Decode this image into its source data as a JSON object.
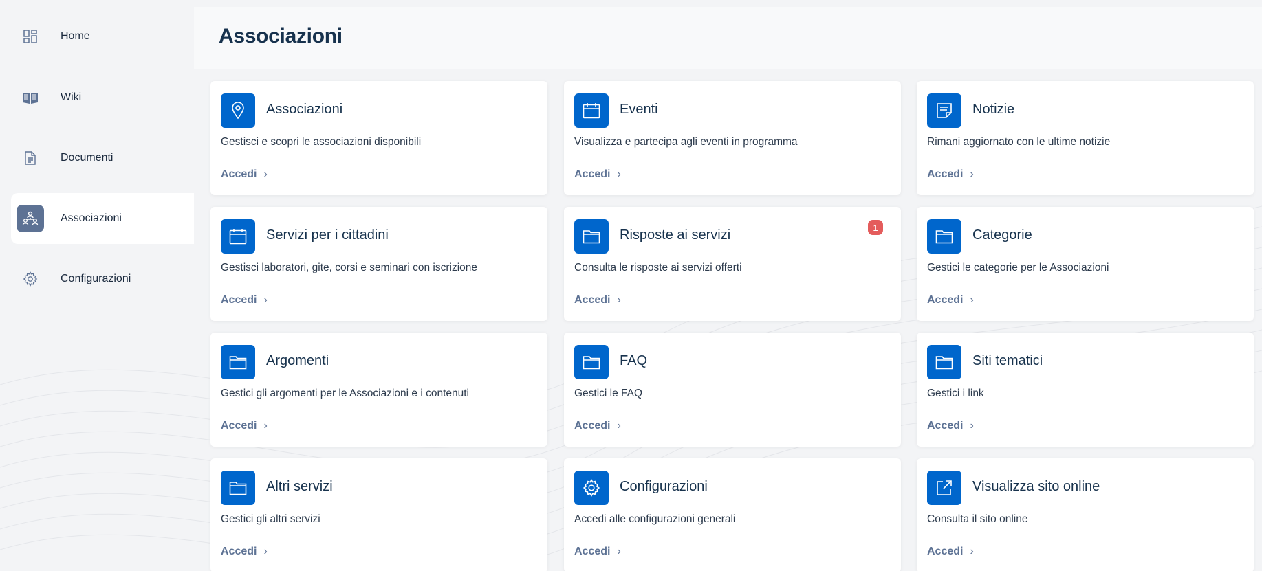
{
  "sidebar": {
    "items": [
      {
        "label": "Home",
        "icon": "dashboard-icon",
        "active": false
      },
      {
        "label": "Wiki",
        "icon": "book-icon",
        "active": false
      },
      {
        "label": "Documenti",
        "icon": "document-icon",
        "active": false
      },
      {
        "label": "Associazioni",
        "icon": "people-network-icon",
        "active": true
      },
      {
        "label": "Configurazioni",
        "icon": "gear-icon",
        "active": false
      }
    ]
  },
  "header": {
    "title": "Associazioni"
  },
  "cards": [
    {
      "title": "Associazioni",
      "description": "Gestisci e scopri le associazioni disponibili",
      "link": "Accedi",
      "icon": "map-pin-icon"
    },
    {
      "title": "Eventi",
      "description": "Visualizza e partecipa agli eventi in programma",
      "link": "Accedi",
      "icon": "calendar-icon"
    },
    {
      "title": "Notizie",
      "description": "Rimani aggiornato con le ultime notizie",
      "link": "Accedi",
      "icon": "news-icon"
    },
    {
      "title": "Servizi per i cittadini",
      "description": "Gestisci laboratori, gite, corsi e seminari con iscrizione",
      "link": "Accedi",
      "icon": "calendar-icon"
    },
    {
      "title": "Risposte ai servizi",
      "description": "Consulta le risposte ai servizi offerti",
      "link": "Accedi",
      "icon": "folder-icon",
      "badge": "1"
    },
    {
      "title": "Categorie",
      "description": "Gestici le categorie per le Associazioni",
      "link": "Accedi",
      "icon": "folder-icon"
    },
    {
      "title": "Argomenti",
      "description": "Gestici gli argomenti per le Associazioni e i contenuti",
      "link": "Accedi",
      "icon": "folder-icon"
    },
    {
      "title": "FAQ",
      "description": "Gestici le FAQ",
      "link": "Accedi",
      "icon": "folder-icon"
    },
    {
      "title": "Siti tematici",
      "description": "Gestici i link",
      "link": "Accedi",
      "icon": "folder-icon"
    },
    {
      "title": "Altri servizi",
      "description": "Gestici gli altri servizi",
      "link": "Accedi",
      "icon": "folder-icon"
    },
    {
      "title": "Configurazioni",
      "description": "Accedi alle configurazioni generali",
      "link": "Accedi",
      "icon": "gear-icon"
    },
    {
      "title": "Visualizza sito online",
      "description": "Consulta il sito online",
      "link": "Accedi",
      "icon": "external-link-icon"
    }
  ],
  "colors": {
    "accent": "#0066cc",
    "link": "#5d7294",
    "badge": "#e45c5c",
    "active_icon_bg": "#5d7294"
  }
}
